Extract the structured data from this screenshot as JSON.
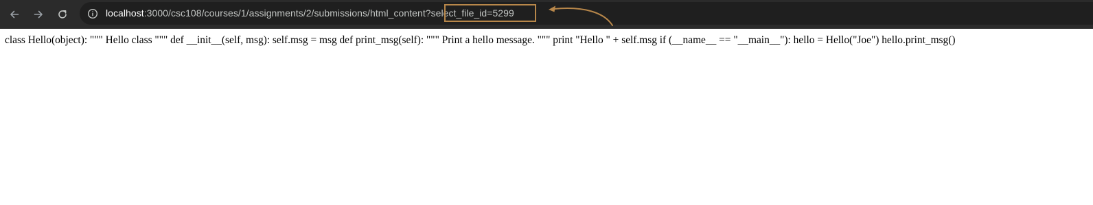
{
  "browser": {
    "url_host": "localhost",
    "url_path": ":3000/csc108/courses/1/assignments/2/submissions/html_content?",
    "url_query": "select_file_id=5299"
  },
  "annotation": {
    "color": "#b8874a"
  },
  "page": {
    "body_text": "class Hello(object): \"\"\" Hello class \"\"\" def __init__(self, msg): self.msg = msg def print_msg(self): \"\"\" Print a hello message. \"\"\" print \"Hello \" + self.msg if (__name__ == \"__main__\"): hello = Hello(\"Joe\") hello.print_msg()"
  }
}
